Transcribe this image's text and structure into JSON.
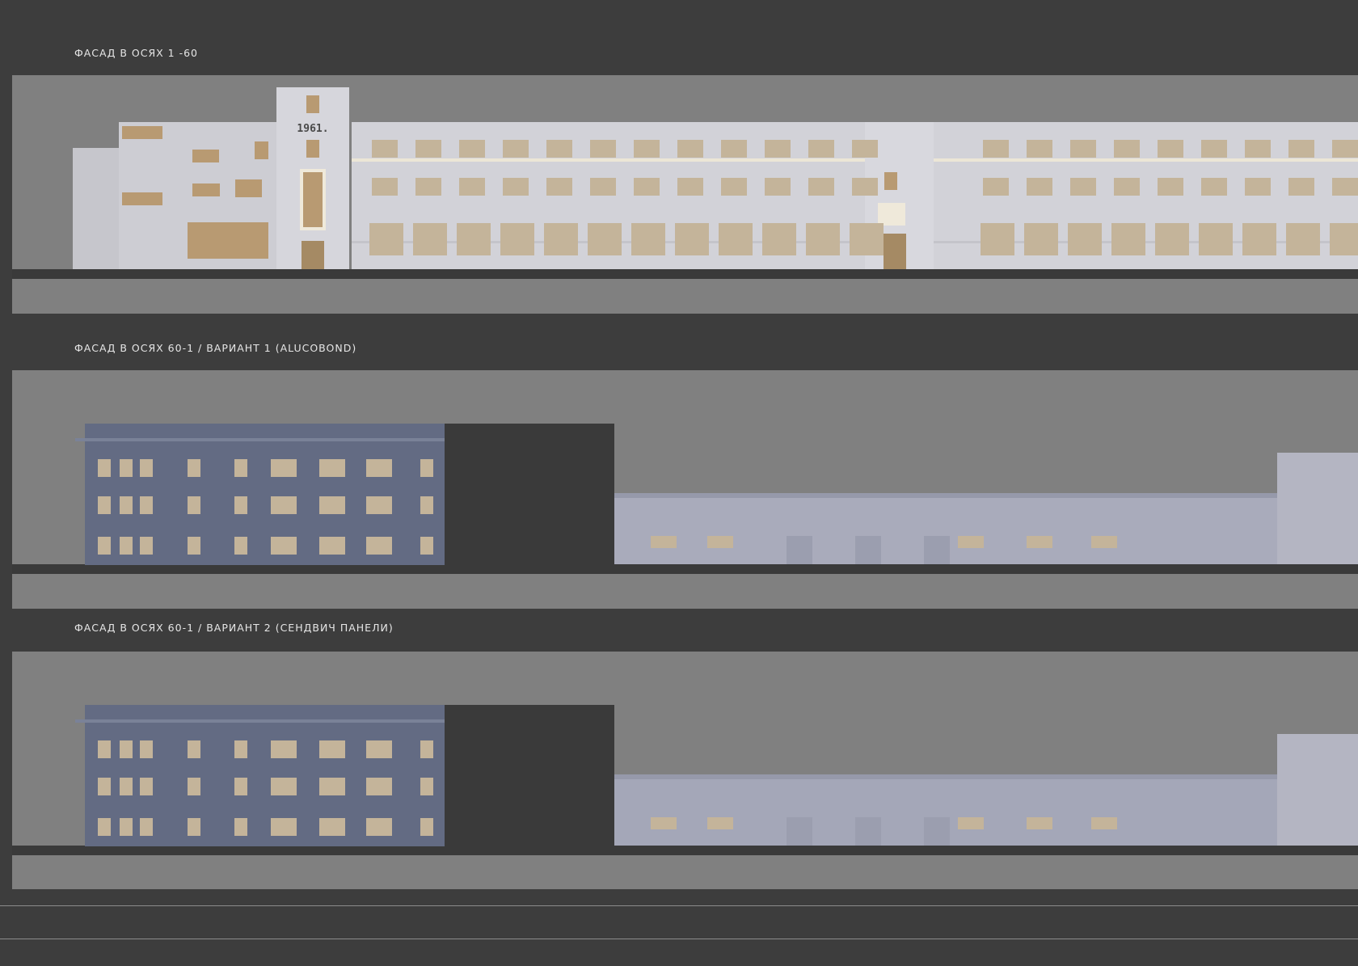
{
  "sheet": {
    "sections": [
      {
        "title": "ФАСАД В ОСЯХ 1 -60"
      },
      {
        "title": "ФАСАД В ОСЯХ 60-1 / ВАРИАНТ  1 (ALUCOBOND)"
      },
      {
        "title": "ФАСАД В ОСЯХ 60-1 / ВАРИАНТ 2 (СЕНДВИЧ ПАНЕЛИ)"
      }
    ],
    "tower_year": "1961."
  },
  "colors": {
    "background": "#3d3d3d",
    "band": "#808080",
    "facade_light": "#cfcfd6",
    "facade_blue": "#636b83",
    "window_lit": "#c4b49a"
  }
}
